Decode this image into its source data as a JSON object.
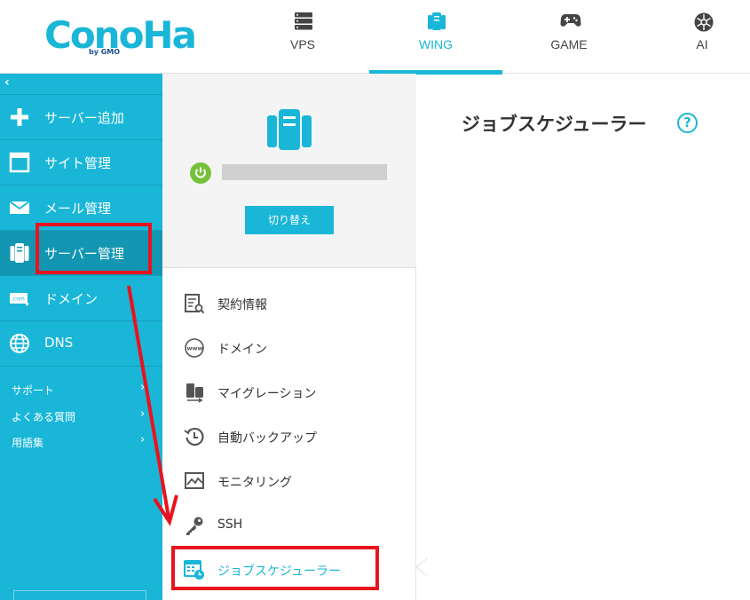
{
  "logo": {
    "text": "ConoHa",
    "sub": "by GMO"
  },
  "topnav": [
    {
      "label": "VPS",
      "icon": "server-rack-icon",
      "active": false
    },
    {
      "label": "WING",
      "icon": "wing-server-icon",
      "active": true
    },
    {
      "label": "GAME",
      "icon": "gamepad-icon",
      "active": false
    },
    {
      "label": "AI",
      "icon": "ai-icon",
      "active": false
    }
  ],
  "sidebar": {
    "collapse": "‹",
    "items": [
      {
        "label": "サーバー追加",
        "icon": "plus-icon"
      },
      {
        "label": "サイト管理",
        "icon": "window-icon"
      },
      {
        "label": "メール管理",
        "icon": "mail-icon"
      },
      {
        "label": "サーバー管理",
        "icon": "server-icon"
      },
      {
        "label": "ドメイン",
        "icon": "domain-icon"
      },
      {
        "label": "DNS",
        "icon": "globe-icon"
      }
    ],
    "support": [
      {
        "label": "サポート"
      },
      {
        "label": "よくある質問"
      },
      {
        "label": "用語集"
      }
    ]
  },
  "server_panel": {
    "switch_label": "切り替え"
  },
  "menu": [
    {
      "label": "契約情報",
      "icon": "contract-icon"
    },
    {
      "label": "ドメイン",
      "icon": "www-icon"
    },
    {
      "label": "マイグレーション",
      "icon": "migration-icon"
    },
    {
      "label": "自動バックアップ",
      "icon": "backup-icon"
    },
    {
      "label": "モニタリング",
      "icon": "monitor-icon"
    },
    {
      "label": "SSH",
      "icon": "key-icon"
    },
    {
      "label": "ジョブスケジューラー",
      "icon": "calendar-clock-icon"
    }
  ],
  "main": {
    "title": "ジョブスケジューラー",
    "help": "?"
  },
  "colors": {
    "accent": "#19b6d8",
    "annotation": "#e8131f",
    "power": "#75c23a"
  }
}
